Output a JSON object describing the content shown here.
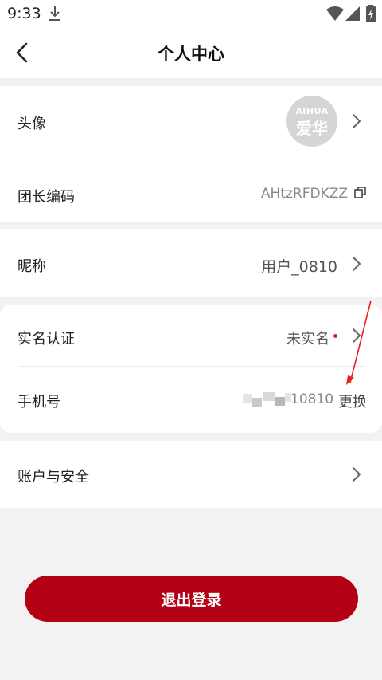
{
  "status_bar": {
    "time": "9:33"
  },
  "header": {
    "title": "个人中心"
  },
  "profile": {
    "avatar_label": "头像",
    "avatar_logo_top": "AIHUA",
    "avatar_logo_main": "爱华",
    "leader_code_label": "团长编码",
    "leader_code_value": "AHtzRFDKZZ"
  },
  "nickname": {
    "label": "昵称",
    "value": "用户_0810"
  },
  "verification": {
    "label": "实名认证",
    "status": "未实名",
    "status_dot_color": "#e02020"
  },
  "phone": {
    "label": "手机号",
    "value_visible": "10810",
    "change_label": "更换"
  },
  "account_security": {
    "label": "账户与安全"
  },
  "logout": {
    "label": "退出登录",
    "color": "#b30015"
  }
}
